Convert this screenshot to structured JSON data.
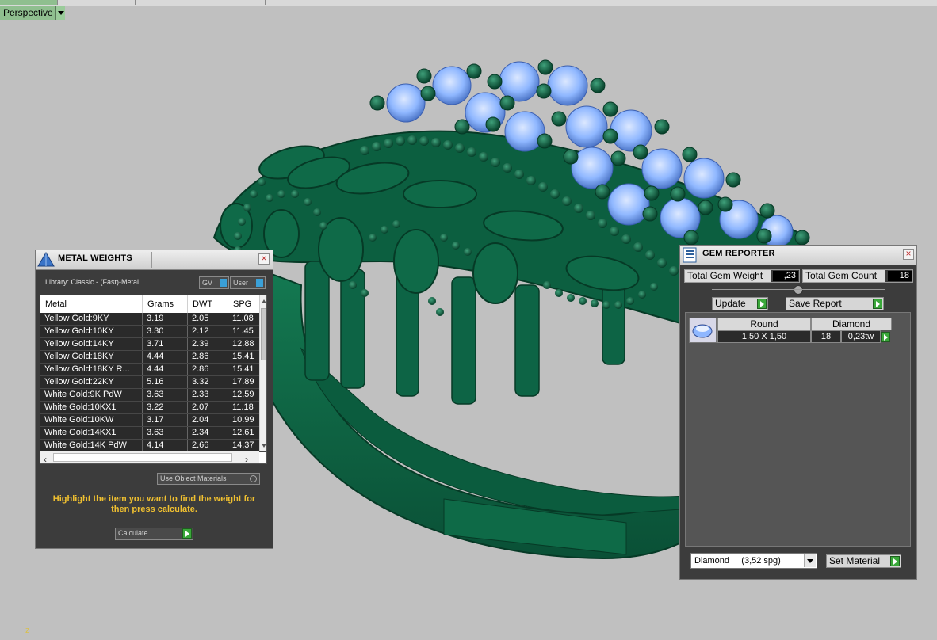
{
  "viewport": {
    "label": "Perspective",
    "axis_label": "z"
  },
  "colors": {
    "background": "#c0c0c0",
    "model_green": "#0f6a48",
    "gem_blue": "#8fb7ff",
    "panel_dark": "#3c3c3c",
    "accent_green": "#3aa83a",
    "hint_yellow": "#f0c030"
  },
  "metal_weights": {
    "title": "METAL WEIGHTS",
    "icon": "pyramid-icon",
    "library": "Library: Classic - (Fast)-Metal",
    "toggle_gv": "GV",
    "toggle_user": "User",
    "columns": [
      "Metal",
      "Grams",
      "DWT",
      "SPG"
    ],
    "rows": [
      {
        "metal": "Yellow Gold:9KY",
        "grams": "3.19",
        "dwt": "2.05",
        "spg": "11.08"
      },
      {
        "metal": "Yellow Gold:10KY",
        "grams": "3.30",
        "dwt": "2.12",
        "spg": "11.45"
      },
      {
        "metal": "Yellow Gold:14KY",
        "grams": "3.71",
        "dwt": "2.39",
        "spg": "12.88"
      },
      {
        "metal": "Yellow Gold:18KY",
        "grams": "4.44",
        "dwt": "2.86",
        "spg": "15.41"
      },
      {
        "metal": "Yellow Gold:18KY R...",
        "grams": "4.44",
        "dwt": "2.86",
        "spg": "15.41"
      },
      {
        "metal": "Yellow Gold:22KY",
        "grams": "5.16",
        "dwt": "3.32",
        "spg": "17.89"
      },
      {
        "metal": "White Gold:9K PdW",
        "grams": "3.63",
        "dwt": "2.33",
        "spg": "12.59"
      },
      {
        "metal": "White Gold:10KX1",
        "grams": "3.22",
        "dwt": "2.07",
        "spg": "11.18"
      },
      {
        "metal": "White Gold:10KW",
        "grams": "3.17",
        "dwt": "2.04",
        "spg": "10.99"
      },
      {
        "metal": "White Gold:14KX1",
        "grams": "3.63",
        "dwt": "2.34",
        "spg": "12.61"
      },
      {
        "metal": "White Gold:14K PdW",
        "grams": "4.14",
        "dwt": "2.66",
        "spg": "14.37"
      }
    ],
    "use_object_materials": "Use Object Materials",
    "hint": "Highlight the item you want to find the weight for then press calculate.",
    "calculate": "Calculate"
  },
  "gem_reporter": {
    "title": "GEM REPORTER",
    "icon": "gem-report-icon",
    "total_weight_label": "Total Gem Weight",
    "total_weight_value": ",23",
    "total_count_label": "Total Gem Count",
    "total_count_value": "18",
    "update": "Update",
    "save_report": "Save Report",
    "gem": {
      "shape": "Round",
      "material": "Diamond",
      "size": "1,50 X 1,50",
      "count": "18",
      "weight": "0,23tw"
    },
    "material_select": "Diamond     (3,52 spg)",
    "set_material": "Set Material"
  }
}
